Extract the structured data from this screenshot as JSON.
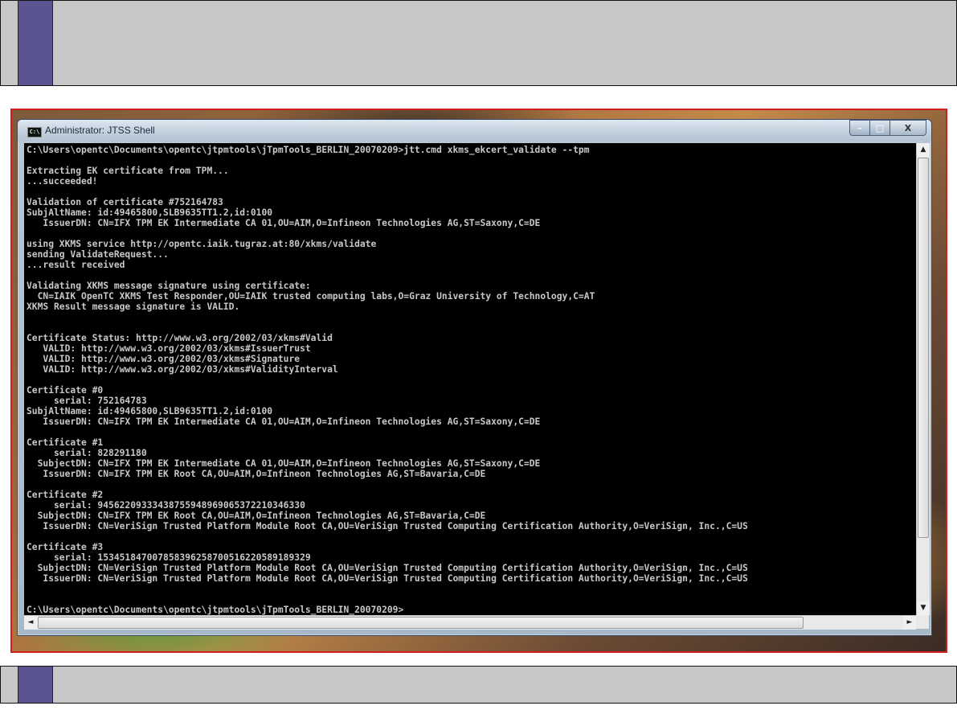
{
  "window": {
    "title": "Administrator: JTSS Shell",
    "icon_label": "C:\\",
    "controls": {
      "minimize": "–",
      "maximize": "□",
      "close": "X"
    }
  },
  "scrollbars": {
    "up": "▲",
    "down": "▼",
    "left": "◄",
    "right": "►"
  },
  "console": {
    "lines": [
      "C:\\Users\\opentc\\Documents\\opentc\\jtpmtools\\jTpmTools_BERLIN_20070209>jtt.cmd xkms_ekcert_validate --tpm",
      "",
      "Extracting EK certificate from TPM...",
      "...succeeded!",
      "",
      "Validation of certificate #752164783",
      "SubjAltName: id:49465800,SLB9635TT1.2,id:0100",
      "   IssuerDN: CN=IFX TPM EK Intermediate CA 01,OU=AIM,O=Infineon Technologies AG,ST=Saxony,C=DE",
      "",
      "using XKMS service http://opentc.iaik.tugraz.at:80/xkms/validate",
      "sending ValidateRequest...",
      "...result received",
      "",
      "Validating XKMS message signature using certificate:",
      "  CN=IAIK OpenTC XKMS Test Responder,OU=IAIK trusted computing labs,O=Graz University of Technology,C=AT",
      "XKMS Result message signature is VALID.",
      "",
      "",
      "Certificate Status: http://www.w3.org/2002/03/xkms#Valid",
      "   VALID: http://www.w3.org/2002/03/xkms#IssuerTrust",
      "   VALID: http://www.w3.org/2002/03/xkms#Signature",
      "   VALID: http://www.w3.org/2002/03/xkms#ValidityInterval",
      "",
      "Certificate #0",
      "     serial: 752164783",
      "SubjAltName: id:49465800,SLB9635TT1.2,id:0100",
      "   IssuerDN: CN=IFX TPM EK Intermediate CA 01,OU=AIM,O=Infineon Technologies AG,ST=Saxony,C=DE",
      "",
      "Certificate #1",
      "     serial: 828291180",
      "  SubjectDN: CN=IFX TPM EK Intermediate CA 01,OU=AIM,O=Infineon Technologies AG,ST=Saxony,C=DE",
      "   IssuerDN: CN=IFX TPM EK Root CA,OU=AIM,O=Infineon Technologies AG,ST=Bavaria,C=DE",
      "",
      "Certificate #2",
      "     serial: 94562209333438755948969065372210346330",
      "  SubjectDN: CN=IFX TPM EK Root CA,OU=AIM,O=Infineon Technologies AG,ST=Bavaria,C=DE",
      "   IssuerDN: CN=VeriSign Trusted Platform Module Root CA,OU=VeriSign Trusted Computing Certification Authority,O=VeriSign, Inc.,C=US",
      "",
      "Certificate #3",
      "     serial: 153451847007858396258700516220589189329",
      "  SubjectDN: CN=VeriSign Trusted Platform Module Root CA,OU=VeriSign Trusted Computing Certification Authority,O=VeriSign, Inc.,C=US",
      "   IssuerDN: CN=VeriSign Trusted Platform Module Root CA,OU=VeriSign Trusted Computing Certification Authority,O=VeriSign, Inc.,C=US",
      "",
      "",
      "C:\\Users\\opentc\\Documents\\opentc\\jtpmtools\\jTpmTools_BERLIN_20070209>"
    ]
  }
}
